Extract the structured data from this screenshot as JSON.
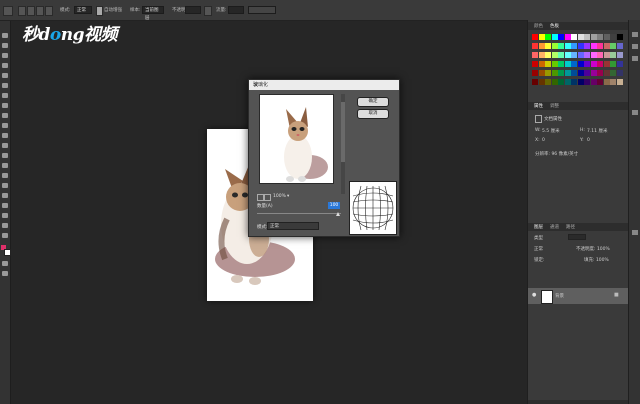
{
  "options_bar": {
    "mode_label": "模式:",
    "mode_value": "正常",
    "opacity_label": "不透明度:",
    "opacity_value": "100%",
    "flow_label": "流量:",
    "flow_value": "100%",
    "sample_label": "样本:",
    "sample_value": "当前图层",
    "edge_label": "自动增强"
  },
  "watermark": {
    "part1": "秒",
    "part2": "d",
    "part3": "o",
    "part4": "ng视频"
  },
  "dialog": {
    "title": "玻璃化",
    "ok": "确定",
    "cancel": "取消",
    "zoom": "100%",
    "amount_label": "数量(A)",
    "amount_value": "100",
    "mode_label": "模式:",
    "mode_value": "正常"
  },
  "panels": {
    "swatches_tabs": [
      "颜色",
      "色板"
    ],
    "properties_tabs": [
      "属性",
      "调整"
    ],
    "properties_title": "文档属性",
    "width_label": "W:",
    "width_value": "5.5 厘米",
    "height_label": "H:",
    "height_value": "7.11 厘米",
    "x_label": "X:",
    "x_value": "0",
    "y_label": "Y:",
    "y_value": "0",
    "resolution_label": "分辨率: 96 像素/英寸",
    "layers_tabs": [
      "图层",
      "通道",
      "路径"
    ],
    "layer_kind": "类型",
    "blend_mode": "正常",
    "opacity": "不透明度: 100%",
    "lock": "锁定:",
    "fill": "填充: 100%",
    "layer_name": "背景"
  },
  "swatch_colors": {
    "row1": [
      "#ff0000",
      "#ffff00",
      "#00ff00",
      "#00ffff",
      "#0000ff",
      "#ff00ff",
      "#ffffff",
      "#e0e0e0",
      "#c0c0c0",
      "#a0a0a0",
      "#808080",
      "#606060",
      "#404040",
      "#000000"
    ],
    "row2": [
      "#ff3333",
      "#ff9933",
      "#ffff33",
      "#99ff33",
      "#33ff99",
      "#33ffff",
      "#3399ff",
      "#3333ff",
      "#9933ff",
      "#ff33ff",
      "#ff3399",
      "#cc6666",
      "#66cc66",
      "#6666cc"
    ],
    "row3": [
      "#ff6666",
      "#ffb366",
      "#ffff66",
      "#b3ff66",
      "#66ffb3",
      "#66ffff",
      "#66b3ff",
      "#6666ff",
      "#b366ff",
      "#ff66ff",
      "#ff66b3",
      "#cc9999",
      "#99cc99",
      "#9999cc"
    ],
    "row4": [
      "#cc0000",
      "#cc6600",
      "#cccc00",
      "#66cc00",
      "#00cc66",
      "#00cccc",
      "#0066cc",
      "#0000cc",
      "#6600cc",
      "#cc00cc",
      "#cc0066",
      "#993333",
      "#339933",
      "#333399"
    ],
    "row5": [
      "#990000",
      "#994d00",
      "#999900",
      "#4d9900",
      "#00994d",
      "#009999",
      "#004d99",
      "#000099",
      "#4d0099",
      "#990099",
      "#99004d",
      "#663333",
      "#336633",
      "#333366"
    ],
    "row6": [
      "#660000",
      "#663300",
      "#666600",
      "#336600",
      "#006633",
      "#006666",
      "#003366",
      "#000066",
      "#330066",
      "#660066",
      "#660033",
      "#8b6b4a",
      "#a0836a",
      "#c8b093"
    ]
  }
}
